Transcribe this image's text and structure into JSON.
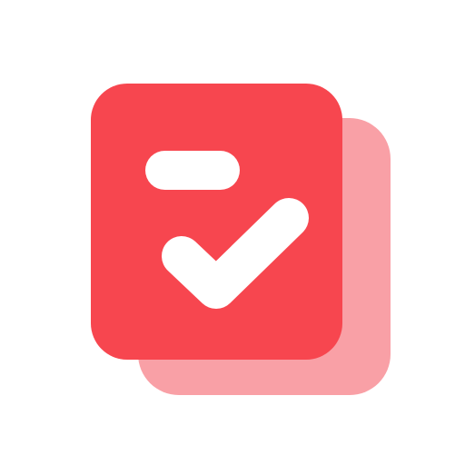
{
  "icon": {
    "name": "task-checklist-app-icon",
    "colors": {
      "background": "#ffffff",
      "front_card": "#f7464f",
      "back_card": "#f9a0a6",
      "glyph": "#ffffff"
    }
  }
}
